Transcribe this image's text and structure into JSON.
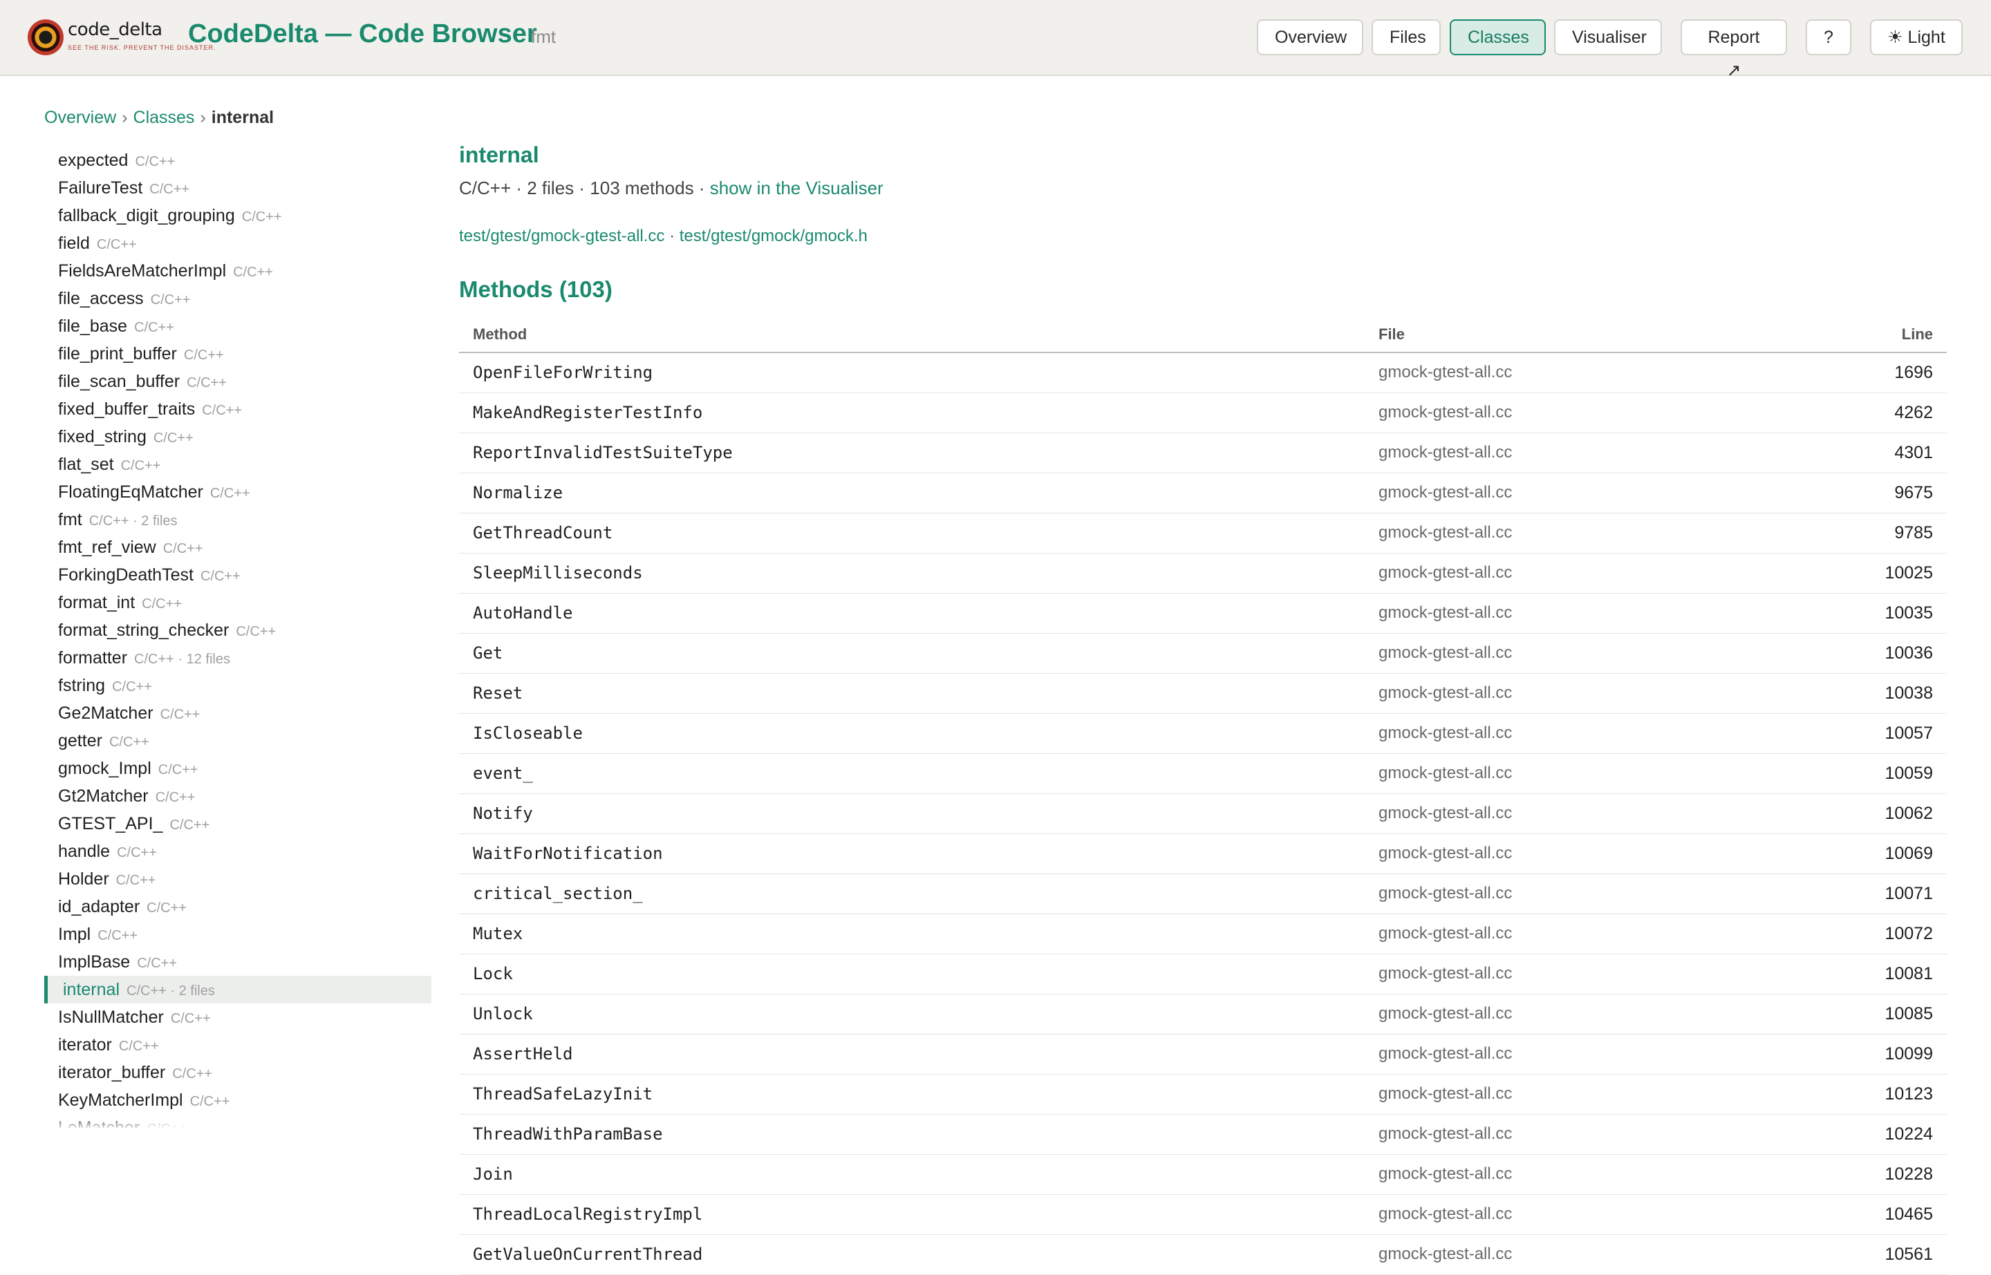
{
  "header": {
    "logo_text": "code_delta",
    "logo_tagline": "SEE THE RISK. PREVENT THE DISASTER.",
    "title": "CodeDelta — Code Browser",
    "project": "fmt",
    "nav": {
      "overview": "Overview",
      "files": "Files",
      "classes": "Classes",
      "visualiser": "Visualiser",
      "report": "Report ↗",
      "help": "?",
      "theme": "☀ Light"
    }
  },
  "breadcrumb": {
    "overview": "Overview",
    "classes": "Classes",
    "current": "internal",
    "sep": "›"
  },
  "sidebar": {
    "items": [
      {
        "name": "expected",
        "meta": "C/C++"
      },
      {
        "name": "FailureTest",
        "meta": "C/C++"
      },
      {
        "name": "fallback_digit_grouping",
        "meta": "C/C++"
      },
      {
        "name": "field",
        "meta": "C/C++"
      },
      {
        "name": "FieldsAreMatcherImpl",
        "meta": "C/C++"
      },
      {
        "name": "file_access",
        "meta": "C/C++"
      },
      {
        "name": "file_base",
        "meta": "C/C++"
      },
      {
        "name": "file_print_buffer",
        "meta": "C/C++"
      },
      {
        "name": "file_scan_buffer",
        "meta": "C/C++"
      },
      {
        "name": "fixed_buffer_traits",
        "meta": "C/C++"
      },
      {
        "name": "fixed_string",
        "meta": "C/C++"
      },
      {
        "name": "flat_set",
        "meta": "C/C++"
      },
      {
        "name": "FloatingEqMatcher",
        "meta": "C/C++"
      },
      {
        "name": "fmt",
        "meta": "C/C++ · 2 files"
      },
      {
        "name": "fmt_ref_view",
        "meta": "C/C++"
      },
      {
        "name": "ForkingDeathTest",
        "meta": "C/C++"
      },
      {
        "name": "format_int",
        "meta": "C/C++"
      },
      {
        "name": "format_string_checker",
        "meta": "C/C++"
      },
      {
        "name": "formatter",
        "meta": "C/C++ · 12 files"
      },
      {
        "name": "fstring",
        "meta": "C/C++"
      },
      {
        "name": "Ge2Matcher",
        "meta": "C/C++"
      },
      {
        "name": "getter",
        "meta": "C/C++"
      },
      {
        "name": "gmock_Impl",
        "meta": "C/C++"
      },
      {
        "name": "Gt2Matcher",
        "meta": "C/C++"
      },
      {
        "name": "GTEST_API_",
        "meta": "C/C++"
      },
      {
        "name": "handle",
        "meta": "C/C++"
      },
      {
        "name": "Holder",
        "meta": "C/C++"
      },
      {
        "name": "id_adapter",
        "meta": "C/C++"
      },
      {
        "name": "Impl",
        "meta": "C/C++"
      },
      {
        "name": "ImplBase",
        "meta": "C/C++"
      },
      {
        "name": "internal",
        "meta": "C/C++ · 2 files",
        "active": true
      },
      {
        "name": "IsNullMatcher",
        "meta": "C/C++"
      },
      {
        "name": "iterator",
        "meta": "C/C++"
      },
      {
        "name": "iterator_buffer",
        "meta": "C/C++"
      },
      {
        "name": "KeyMatcherImpl",
        "meta": "C/C++"
      },
      {
        "name": "LeMatcher",
        "meta": "C/C++"
      }
    ]
  },
  "main": {
    "class_name": "internal",
    "meta_text": "C/C++ · 2 files · 103 methods · ",
    "visualiser_link": "show in the Visualiser",
    "file1": "test/gtest/gmock-gtest-all.cc",
    "file_sep": " · ",
    "file2": "test/gtest/gmock/gmock.h",
    "methods_heading": "Methods (103)",
    "columns": {
      "method": "Method",
      "file": "File",
      "line": "Line"
    },
    "methods": [
      {
        "method": "OpenFileForWriting",
        "file": "gmock-gtest-all.cc",
        "line": "1696"
      },
      {
        "method": "MakeAndRegisterTestInfo",
        "file": "gmock-gtest-all.cc",
        "line": "4262"
      },
      {
        "method": "ReportInvalidTestSuiteType",
        "file": "gmock-gtest-all.cc",
        "line": "4301"
      },
      {
        "method": "Normalize",
        "file": "gmock-gtest-all.cc",
        "line": "9675"
      },
      {
        "method": "GetThreadCount",
        "file": "gmock-gtest-all.cc",
        "line": "9785"
      },
      {
        "method": "SleepMilliseconds",
        "file": "gmock-gtest-all.cc",
        "line": "10025"
      },
      {
        "method": "AutoHandle",
        "file": "gmock-gtest-all.cc",
        "line": "10035"
      },
      {
        "method": "Get",
        "file": "gmock-gtest-all.cc",
        "line": "10036"
      },
      {
        "method": "Reset",
        "file": "gmock-gtest-all.cc",
        "line": "10038"
      },
      {
        "method": "IsCloseable",
        "file": "gmock-gtest-all.cc",
        "line": "10057"
      },
      {
        "method": "event_",
        "file": "gmock-gtest-all.cc",
        "line": "10059"
      },
      {
        "method": "Notify",
        "file": "gmock-gtest-all.cc",
        "line": "10062"
      },
      {
        "method": "WaitForNotification",
        "file": "gmock-gtest-all.cc",
        "line": "10069"
      },
      {
        "method": "critical_section_",
        "file": "gmock-gtest-all.cc",
        "line": "10071"
      },
      {
        "method": "Mutex",
        "file": "gmock-gtest-all.cc",
        "line": "10072"
      },
      {
        "method": "Lock",
        "file": "gmock-gtest-all.cc",
        "line": "10081"
      },
      {
        "method": "Unlock",
        "file": "gmock-gtest-all.cc",
        "line": "10085"
      },
      {
        "method": "AssertHeld",
        "file": "gmock-gtest-all.cc",
        "line": "10099"
      },
      {
        "method": "ThreadSafeLazyInit",
        "file": "gmock-gtest-all.cc",
        "line": "10123"
      },
      {
        "method": "ThreadWithParamBase",
        "file": "gmock-gtest-all.cc",
        "line": "10224"
      },
      {
        "method": "Join",
        "file": "gmock-gtest-all.cc",
        "line": "10228"
      },
      {
        "method": "ThreadLocalRegistryImpl",
        "file": "gmock-gtest-all.cc",
        "line": "10465"
      },
      {
        "method": "GetValueOnCurrentThread",
        "file": "gmock-gtest-all.cc",
        "line": "10561"
      }
    ]
  },
  "colors": {
    "accent": "#1a8a6e",
    "header_bg": "#f1f0ec",
    "active_bg": "#d6ece4"
  }
}
